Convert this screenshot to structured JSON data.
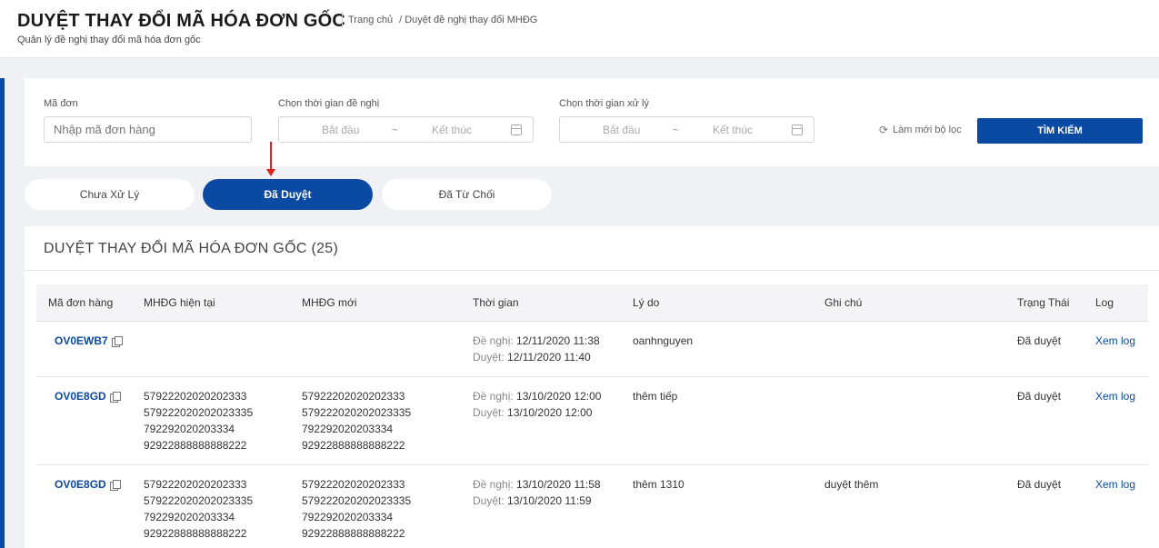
{
  "header": {
    "title": "DUYỆT THAY ĐỔI MÃ HÓA ĐƠN GỐC",
    "subtitle": "Quản lý đề nghị thay đổi mã hóa đơn gốc",
    "breadcrumb": {
      "home": "Trang chủ",
      "current": "/ Duyệt đề nghị thay đổi MHĐG"
    }
  },
  "filters": {
    "order_code": {
      "label": "Mã đơn",
      "placeholder": "Nhập mã đơn hàng"
    },
    "request_time": {
      "label": "Chọn thời gian đề nghị",
      "start": "Bắt đầu",
      "separator": "~",
      "end": "Kết thúc"
    },
    "process_time": {
      "label": "Chọn thời gian xử lý",
      "start": "Bắt đầu",
      "separator": "~",
      "end": "Kết thúc"
    },
    "reset_label": "Làm mới bộ lọc",
    "search_label": "TÌM KIẾM"
  },
  "tabs": [
    {
      "label": "Chưa Xử Lý",
      "active": false
    },
    {
      "label": "Đã Duyệt",
      "active": true
    },
    {
      "label": "Đã Từ Chối",
      "active": false
    }
  ],
  "table": {
    "title": "DUYỆT THAY ĐỔI MÃ HÓA ĐƠN GỐC (25)",
    "headers": [
      "Mã đơn hàng",
      "MHĐG hiện tại",
      "MHĐG mới",
      "Thời gian",
      "Lý do",
      "Ghi chú",
      "Trạng Thái",
      "Log"
    ],
    "rows": [
      {
        "code": "OV0EWB7",
        "current": [
          "",
          "",
          "",
          ""
        ],
        "new": [
          "",
          "",
          "",
          ""
        ],
        "requested_label": "Đề nghị:",
        "requested": "12/11/2020 11:38",
        "approved_label": "Duyệt:",
        "approved": "12/11/2020 11:40",
        "reason": "oanhnguyen",
        "note": "",
        "status": "Đã duyệt",
        "log": "Xem log"
      },
      {
        "code": "OV0E8GD",
        "current": [
          "57922202020202333",
          "579222020202023335",
          "792292020203334",
          "92922888888888222"
        ],
        "new": [
          "57922202020202333",
          "579222020202023335",
          "792292020203334",
          "92922888888888222"
        ],
        "requested_label": "Đề nghị:",
        "requested": "13/10/2020 12:00",
        "approved_label": "Duyệt:",
        "approved": "13/10/2020 12:00",
        "reason": "thêm tiếp",
        "note": "",
        "status": "Đã duyệt",
        "log": "Xem log"
      },
      {
        "code": "OV0E8GD",
        "current": [
          "57922202020202333",
          "579222020202023335",
          "792292020203334",
          "92922888888888222"
        ],
        "new": [
          "57922202020202333",
          "579222020202023335",
          "792292020203334",
          "92922888888888222"
        ],
        "requested_label": "Đề nghị:",
        "requested": "13/10/2020 11:58",
        "approved_label": "Duyệt:",
        "approved": "13/10/2020 11:59",
        "reason": "thêm 1310",
        "note": "duyệt thêm",
        "status": "Đã duyệt",
        "log": "Xem log"
      }
    ]
  },
  "colors": {
    "primary": "#0b4aa2",
    "annotation_arrow": "#e0201a",
    "background": "#f0f1f5"
  }
}
